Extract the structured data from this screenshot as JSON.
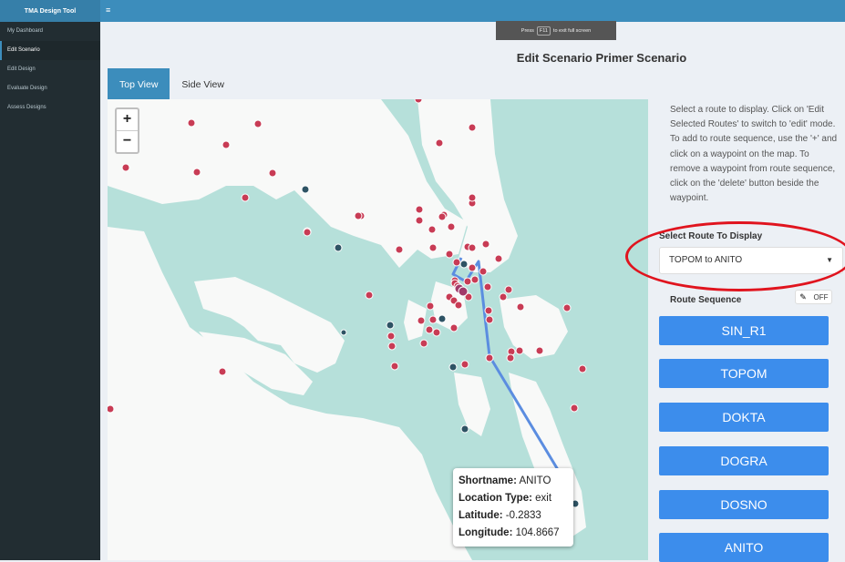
{
  "app": {
    "brand": "TMA Design Tool",
    "menu_icon": "hamburger-icon"
  },
  "sidebar": {
    "items": [
      {
        "label": "My Dashboard"
      },
      {
        "label": "Edit Scenario"
      },
      {
        "label": "Edit Design"
      },
      {
        "label": "Evaluate Design"
      },
      {
        "label": "Assess Designs"
      }
    ]
  },
  "banner": {
    "prefix": "Press",
    "key": "F11",
    "suffix": "to exit full screen"
  },
  "page": {
    "title": "Edit Scenario Primer Scenario"
  },
  "tabs": [
    {
      "label": "Top View"
    },
    {
      "label": "Side View"
    }
  ],
  "map": {
    "zoom_in": "+",
    "zoom_out": "−",
    "colors": {
      "sea": "#b6e0da",
      "land": "#f8f9f8",
      "waypoint": "#c83c55",
      "exit": "#2e5364",
      "route": "#5b8de0"
    },
    "popup": {
      "shortname_label": "Shortname:",
      "shortname": "ANITO",
      "type_label": "Location Type:",
      "type": "exit",
      "lat_label": "Latitude:",
      "lat": "-0.2833",
      "lon_label": "Longitude:",
      "lon": "104.8667"
    }
  },
  "panel": {
    "instructions": "Select a route to display. Click on 'Edit Selected Routes' to switch to 'edit' mode. To add to route sequence, use the '+' and click on a waypoint on the map. To remove a waypoint from route sequence, click on the 'delete' button beside the waypoint.",
    "select_label": "Select Route To Display",
    "selected_route": "TOPOM to ANITO",
    "route_sequence_label": "Route Sequence",
    "edit_toggle": "OFF",
    "waypoints": [
      "SIN_R1",
      "TOPOM",
      "DOKTA",
      "DOGRA",
      "DOSNO",
      "ANITO"
    ]
  }
}
